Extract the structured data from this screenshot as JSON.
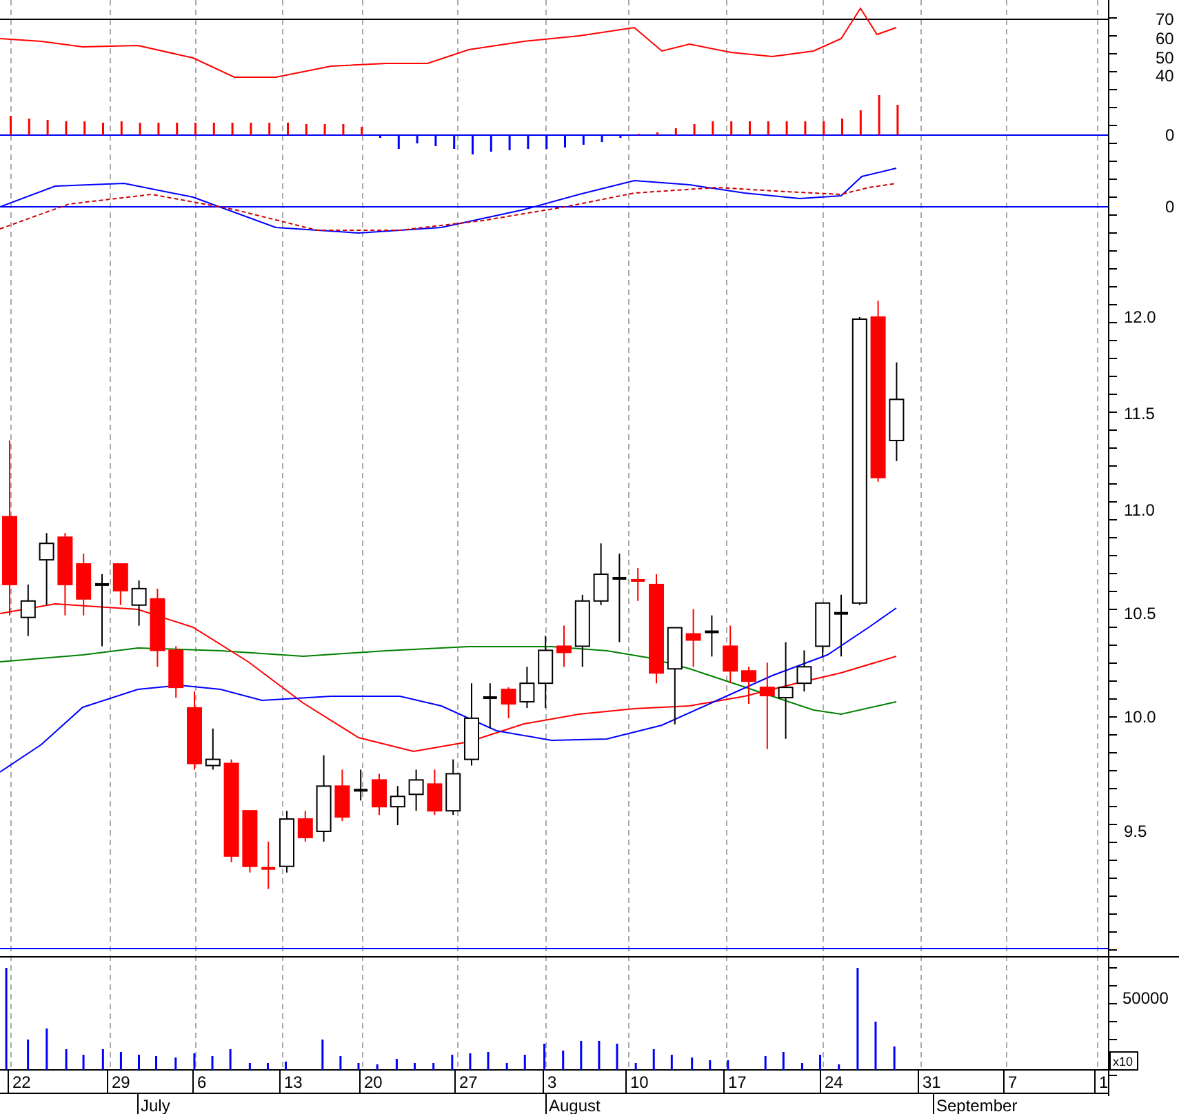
{
  "rsi_panel": {
    "y_ticks": [
      "70",
      "60",
      "50",
      "40"
    ]
  },
  "histogram_panel": {
    "y_ticks": [
      "0"
    ]
  },
  "macd_panel": {
    "y_ticks": [
      "0"
    ]
  },
  "price_panel": {
    "y_ticks": [
      "12.0",
      "11.5",
      "11.0",
      "10.5",
      "10.0",
      "9.5"
    ]
  },
  "volume_panel": {
    "y_ticks": [
      "50000"
    ],
    "multiplier": "x10"
  },
  "date_axis": {
    "days": [
      "22",
      "29",
      "6",
      "13",
      "20",
      "27",
      "3",
      "10",
      "17",
      "24",
      "31",
      "7",
      "1"
    ],
    "months": [
      "July",
      "August",
      "September"
    ]
  }
}
